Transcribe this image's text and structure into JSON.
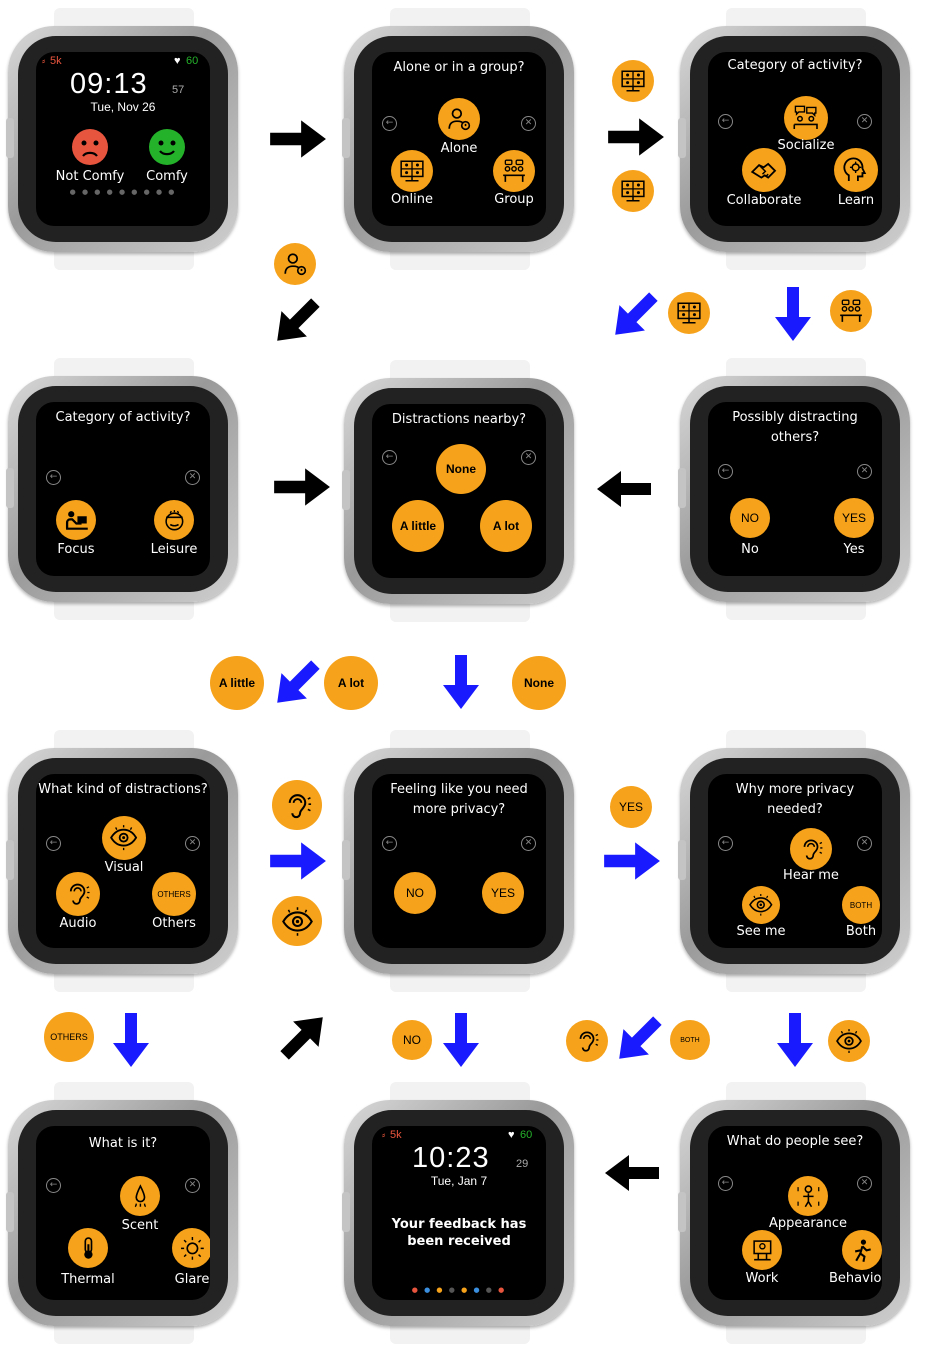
{
  "screens": {
    "s1": {
      "steps": "5k",
      "heart": "60",
      "time": "09:13",
      "secs": "57",
      "date": "Tue, Nov 26",
      "not_comfy": "Not Comfy",
      "comfy": "Comfy"
    },
    "s2": {
      "question": "Alone or in a group?",
      "alone": "Alone",
      "online": "Online",
      "group": "Group"
    },
    "s3": {
      "question": "Category of activity?",
      "socialize": "Socialize",
      "collaborate": "Collaborate",
      "learn": "Learn"
    },
    "s4": {
      "question": "Category of activity?",
      "focus": "Focus",
      "leisure": "Leisure"
    },
    "s5": {
      "question": "Distractions nearby?",
      "none": "None",
      "a_little": "A little",
      "a_lot": "A lot"
    },
    "s6": {
      "question_line1": "Possibly distracting",
      "question_line2": "others?",
      "no_btn": "NO",
      "yes_btn": "YES",
      "no": "No",
      "yes": "Yes"
    },
    "s7": {
      "question": "What kind of distractions?",
      "visual": "Visual",
      "audio": "Audio",
      "others": "Others",
      "others_btn": "OTHERS"
    },
    "s8": {
      "question_line1": "Feeling like you need",
      "question_line2": "more privacy?",
      "no_btn": "NO",
      "yes_btn": "YES"
    },
    "s9": {
      "question_line1": "Why more privacy",
      "question_line2": "needed?",
      "hear_me": "Hear me",
      "see_me": "See me",
      "both": "Both",
      "both_btn": "BOTH"
    },
    "s10": {
      "question": "What is it?",
      "scent": "Scent",
      "thermal": "Thermal",
      "glare": "Glare"
    },
    "s11": {
      "steps": "5k",
      "heart": "60",
      "time": "10:23",
      "secs": "29",
      "date": "Tue, Jan 7",
      "msg_line1": "Your feedback has",
      "msg_line2": "been received"
    },
    "s12": {
      "question": "What do people see?",
      "appearance": "Appearance",
      "work": "Work",
      "behaviour": "Behaviour"
    }
  },
  "chips": {
    "a_little": "A little",
    "a_lot": "A lot",
    "none": "None",
    "yes": "YES",
    "others": "OTHERS",
    "no": "NO",
    "both": "BOTH"
  },
  "icons": {
    "back": "back-arrow-icon",
    "close": "close-x-icon",
    "sad": "sad-face-icon",
    "happy": "happy-face-icon",
    "person": "person-icon",
    "online": "online-meeting-icon",
    "group": "group-table-icon",
    "ear": "ear-icon",
    "eye": "eye-icon"
  },
  "colors": {
    "accent": "#f6a21a",
    "arrow_black": "#000000",
    "arrow_blue": "#1a1aff",
    "sad": "#e8553e",
    "happy": "#25b22b"
  }
}
